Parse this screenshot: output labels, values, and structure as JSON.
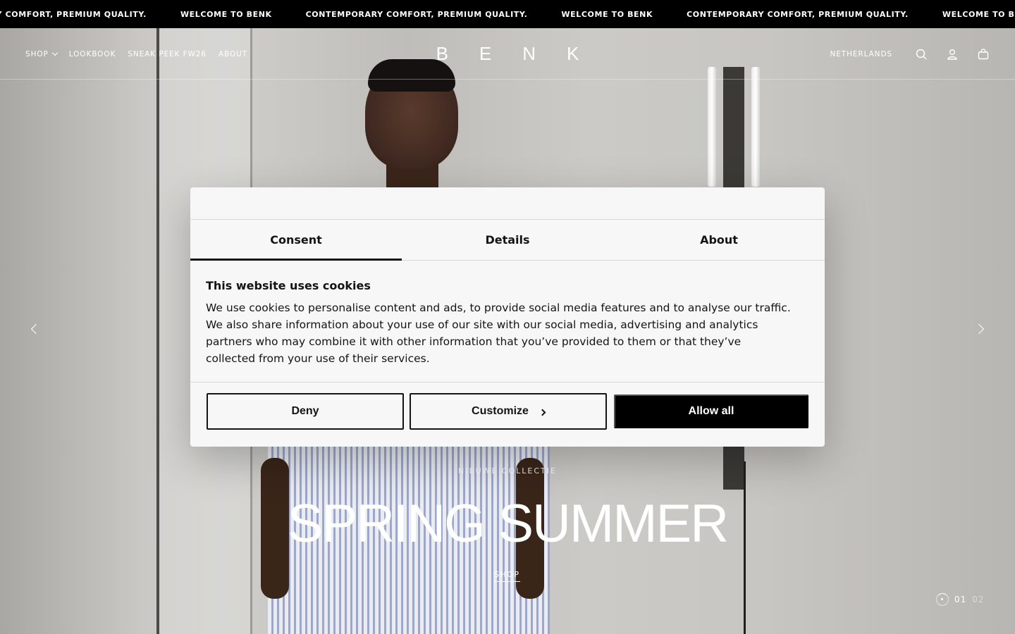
{
  "announcement": {
    "items": [
      "ORARY COMFORT, PREMIUM QUALITY.",
      "WELCOME TO BENK",
      "CONTEMPORARY COMFORT, PREMIUM QUALITY.",
      "WELCOME TO BENK",
      "CONTEMPORARY COMFORT, PREMIUM QUALITY.",
      "WELCOME TO B"
    ]
  },
  "header": {
    "nav": [
      {
        "label": "Shop",
        "has_dropdown": true
      },
      {
        "label": "Lookbook"
      },
      {
        "label": "Sneak Peek FW26"
      },
      {
        "label": "About"
      }
    ],
    "logo": "BENK",
    "country": "Netherlands",
    "icons": [
      "search-icon",
      "account-icon",
      "cart-icon"
    ]
  },
  "hero": {
    "eyebrow": "Nieuwe collectie",
    "title": "SPRING SUMMER",
    "cta": "Shop",
    "pager": {
      "current": "01",
      "next": "02"
    }
  },
  "cookie_modal": {
    "tabs": [
      {
        "label": "Consent",
        "active": true
      },
      {
        "label": "Details",
        "active": false
      },
      {
        "label": "About",
        "active": false
      }
    ],
    "heading": "This website uses cookies",
    "body": "We use cookies to personalise content and ads, to provide social media features and to analyse our traffic. We also share information about your use of our site with our social media, advertising and analytics partners who may combine it with other information that you’ve provided to them or that they’ve collected from your use of their services.",
    "buttons": {
      "deny": "Deny",
      "customize": "Customize",
      "allow_all": "Allow all"
    }
  }
}
